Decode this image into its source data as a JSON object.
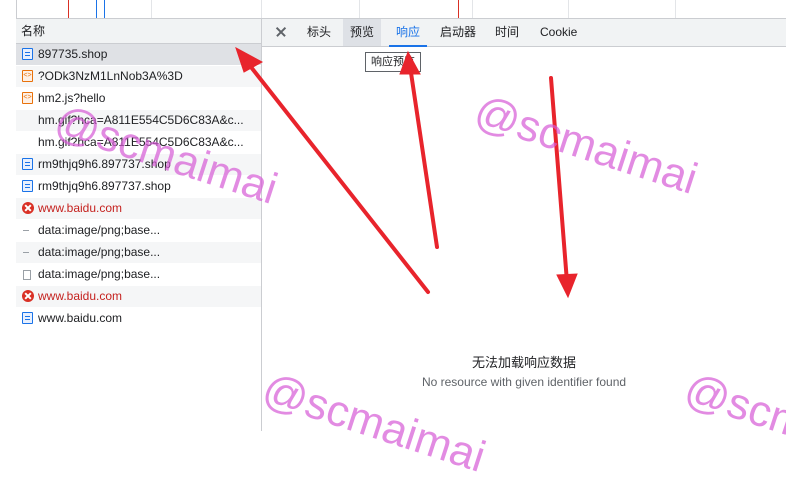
{
  "request_list": {
    "header": "名称",
    "rows": [
      {
        "name": "897735.shop",
        "icon": "document-icon",
        "status": "selected"
      },
      {
        "name": "?ODk3NzM1LnNob3A%3D",
        "icon": "script-icon",
        "status": "ok"
      },
      {
        "name": "hm2.js?hello",
        "icon": "script-icon",
        "status": "ok"
      },
      {
        "name": "hm.gif?hca=A811E554C5D6C83A&c...",
        "icon": "none",
        "status": "ok"
      },
      {
        "name": "hm.gif?hca=A811E554C5D6C83A&c...",
        "icon": "none",
        "status": "ok"
      },
      {
        "name": "rm9thjq9h6.897737.shop",
        "icon": "document-icon",
        "status": "ok"
      },
      {
        "name": "rm9thjq9h6.897737.shop",
        "icon": "document-icon",
        "status": "ok"
      },
      {
        "name": "www.baidu.com",
        "icon": "error-icon",
        "status": "error"
      },
      {
        "name": "data:image/png;base...",
        "icon": "dash-icon",
        "status": "ok"
      },
      {
        "name": "data:image/png;base...",
        "icon": "dash-icon",
        "status": "ok"
      },
      {
        "name": "data:image/png;base...",
        "icon": "file-icon",
        "status": "ok"
      },
      {
        "name": "www.baidu.com",
        "icon": "error-icon",
        "status": "error"
      },
      {
        "name": "www.baidu.com",
        "icon": "document-icon",
        "status": "ok"
      }
    ]
  },
  "detail": {
    "tabs": [
      "标头",
      "预览",
      "响应",
      "启动器",
      "时间",
      "Cookie"
    ],
    "active_tab": "响应",
    "hover_tab": "预览",
    "tooltip": "响应预览",
    "empty_title": "无法加载响应数据",
    "empty_subtitle": "No resource with given identifier found"
  },
  "watermark": "@scmaimai",
  "colors": {
    "accent": "#1a73e8",
    "error": "#c5221f",
    "arrow": "#e8242c",
    "watermark": "#d65bd6"
  }
}
